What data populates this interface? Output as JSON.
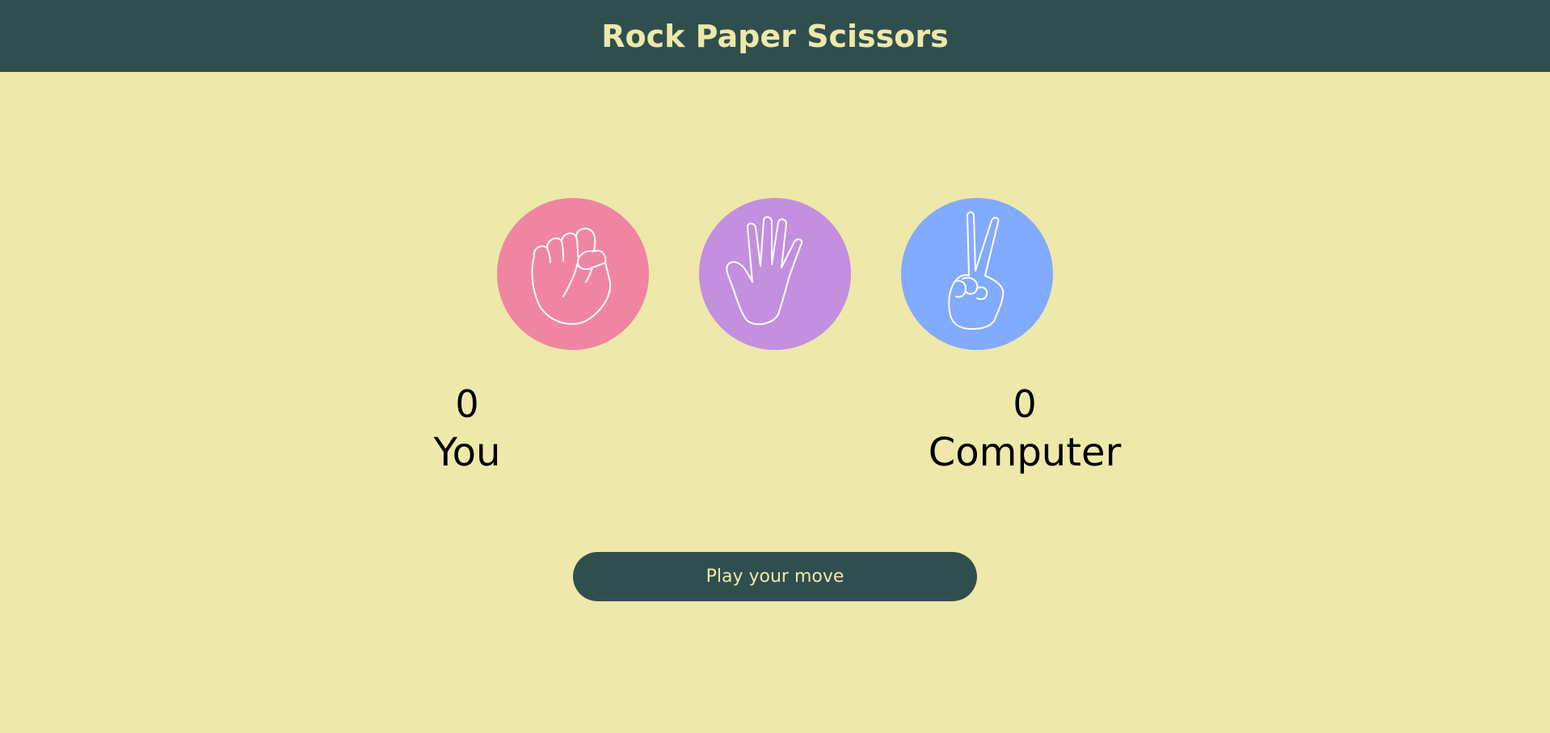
{
  "header": {
    "title": "Rock Paper Scissors"
  },
  "choices": [
    {
      "id": "rock",
      "icon": "fist-hand-icon",
      "color": "#F085A2"
    },
    {
      "id": "paper",
      "icon": "open-hand-icon",
      "color": "#C38FDF"
    },
    {
      "id": "scissors",
      "icon": "peace-hand-icon",
      "color": "#82AAFF"
    }
  ],
  "scoreboard": {
    "user": {
      "score": "0",
      "label": "You"
    },
    "computer": {
      "score": "0",
      "label": "Computer"
    }
  },
  "message": {
    "text": "Play your move"
  },
  "colors": {
    "background": "#EEE8AA",
    "primary": "#2F4F4F",
    "accent_text": "#EEE8AA"
  }
}
